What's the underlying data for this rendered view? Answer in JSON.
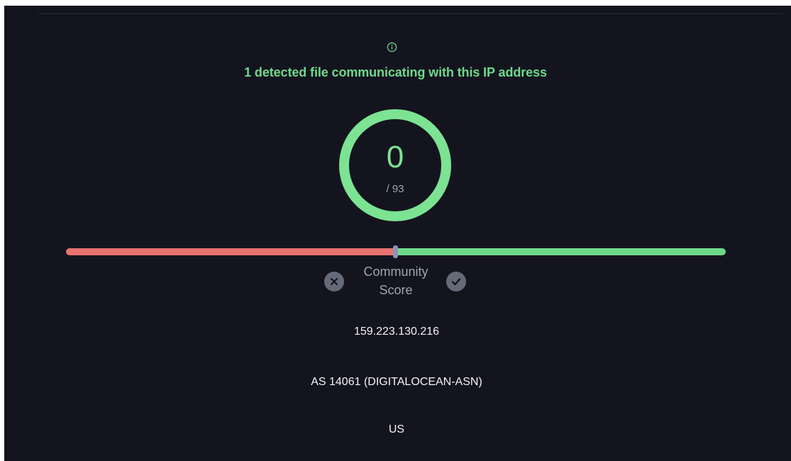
{
  "detection": {
    "message": "1 detected file communicating with this IP address",
    "info_icon": "info-circle-icon",
    "color": "#6fd98a"
  },
  "score": {
    "value": "0",
    "total": "/ 93",
    "ring_color": "#7be392",
    "detections": 0,
    "engines": 93
  },
  "community": {
    "label_line1": "Community",
    "label_line2": "Score",
    "score_position_fraction": 0.5,
    "negative_color": "#e8736f",
    "positive_color": "#6fd98a",
    "vote_down_icon": "x-circle-icon",
    "vote_up_icon": "check-circle-icon"
  },
  "details": {
    "ip": "159.223.130.216",
    "asn": "AS 14061 (DIGITALOCEAN-ASN)",
    "country": "US"
  },
  "theme": {
    "background": "#14141f",
    "text": "#f2f2f5",
    "muted": "#a0a3b1"
  }
}
